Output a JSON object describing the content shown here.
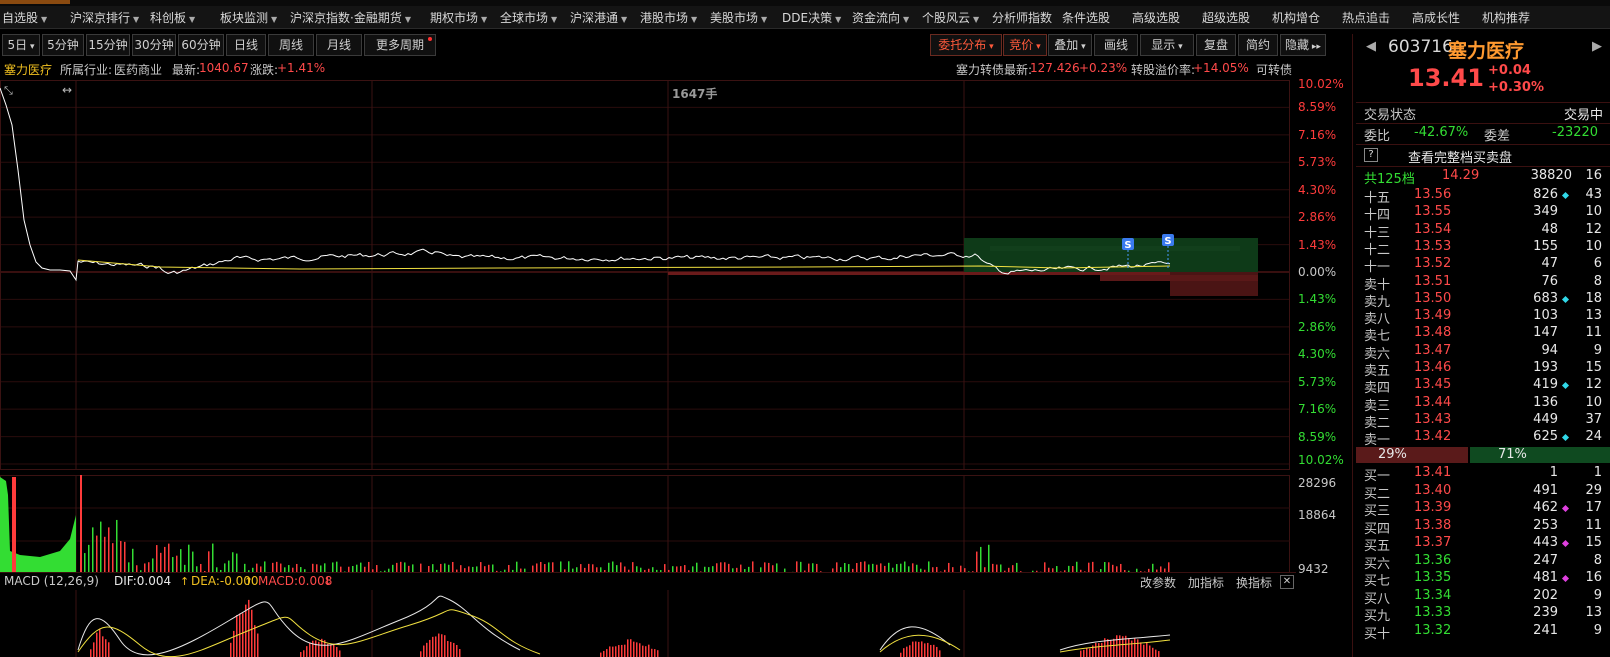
{
  "menu": [
    {
      "label": "自选股",
      "dd": true
    },
    {
      "label": "沪深京排行",
      "dd": true
    },
    {
      "label": "科创板",
      "dd": true
    },
    {
      "label": "板块监测",
      "dd": true
    },
    {
      "label": "沪深京指数·金融期货",
      "dd": true
    },
    {
      "label": "期权市场",
      "dd": true
    },
    {
      "label": "全球市场",
      "dd": true
    },
    {
      "label": "沪深港通",
      "dd": true
    },
    {
      "label": "港股市场",
      "dd": true
    },
    {
      "label": "美股市场",
      "dd": true
    },
    {
      "label": "DDE决策",
      "dd": true
    },
    {
      "label": "资金流向",
      "dd": true
    },
    {
      "label": "个股风云",
      "dd": true
    },
    {
      "label": "分析师指数",
      "dd": false
    },
    {
      "label": "条件选股",
      "dd": false
    },
    {
      "label": "高级选股",
      "dd": false
    },
    {
      "label": "超级选股",
      "dd": false
    },
    {
      "label": "机构增仓",
      "dd": false
    },
    {
      "label": "热点追击",
      "dd": false
    },
    {
      "label": "高成长性",
      "dd": false
    },
    {
      "label": "机构推荐",
      "dd": false
    }
  ],
  "periods": [
    "5日",
    "5分钟",
    "15分钟",
    "30分钟",
    "60分钟",
    "日线",
    "周线",
    "月线",
    "更多周期"
  ],
  "tools": [
    "委托分布",
    "竞价",
    "叠加",
    "画线",
    "显示",
    "复盘",
    "简约",
    "隐藏"
  ],
  "info": {
    "name": "塞力医疗",
    "industry_label": "所属行业:",
    "industry": "医药商业",
    "last_label": "最新:",
    "last": "1040.67",
    "chg_label": "涨跌:",
    "chg": "+1.41%",
    "cb_label": "塞力转债最新:",
    "cb_price": "127.426",
    "cb_chg": "+0.23%",
    "premium_label": "转股溢价率:",
    "premium": "+14.05%",
    "convertible": "可转债"
  },
  "chart": {
    "center_text": "1647手",
    "pct_up": [
      "10.02%",
      "8.59%",
      "7.16%",
      "5.73%",
      "4.30%",
      "2.86%",
      "1.43%"
    ],
    "pct_zero": "0.00%",
    "pct_down": [
      "1.43%",
      "2.86%",
      "4.30%",
      "5.73%",
      "7.16%",
      "8.59%",
      "10.02%"
    ],
    "vol_labels": [
      "28296",
      "18864",
      "9432"
    ],
    "marker": "S",
    "colors": {
      "up": "#ff3b3b",
      "down": "#33dd33",
      "price_line": "#ffffff",
      "avg_line": "#f0e040",
      "grid": "#2a0c0c"
    }
  },
  "macd": {
    "name": "MACD (12,26,9)",
    "dif": "DIF:0.004",
    "dea": "DEA:-0.000",
    "macd": "MACD:0.008",
    "btn_params": "改参数",
    "btn_add": "加指标",
    "btn_switch": "换指标",
    "close": "✕"
  },
  "stock": {
    "code": "603716",
    "name": "塞力医疗",
    "price": "13.41",
    "change": "+0.04",
    "change_pct": "+0.30%",
    "status_label": "交易状态",
    "status": "交易中",
    "weibi_label": "委比",
    "weibi": "-42.67%",
    "weicha_label": "委差",
    "weicha": "-23220",
    "help": "?",
    "full_book": "查看完整档买卖盘",
    "total_label": "共125档",
    "total_price": "14.29",
    "total_vol": "38820",
    "total_count": "16"
  },
  "asks": [
    {
      "label": "十五",
      "price": "13.56",
      "vol": "826",
      "mark": "cyan",
      "count": "43"
    },
    {
      "label": "十四",
      "price": "13.55",
      "vol": "349",
      "mark": "",
      "count": "10"
    },
    {
      "label": "十三",
      "price": "13.54",
      "vol": "48",
      "mark": "",
      "count": "12"
    },
    {
      "label": "十二",
      "price": "13.53",
      "vol": "155",
      "mark": "",
      "count": "10"
    },
    {
      "label": "十一",
      "price": "13.52",
      "vol": "47",
      "mark": "",
      "count": "6"
    },
    {
      "label": "卖十",
      "price": "13.51",
      "vol": "76",
      "mark": "",
      "count": "8"
    },
    {
      "label": "卖九",
      "price": "13.50",
      "vol": "683",
      "mark": "cyan",
      "count": "18"
    },
    {
      "label": "卖八",
      "price": "13.49",
      "vol": "103",
      "mark": "",
      "count": "13"
    },
    {
      "label": "卖七",
      "price": "13.48",
      "vol": "147",
      "mark": "",
      "count": "11"
    },
    {
      "label": "卖六",
      "price": "13.47",
      "vol": "94",
      "mark": "",
      "count": "9"
    },
    {
      "label": "卖五",
      "price": "13.46",
      "vol": "193",
      "mark": "",
      "count": "15"
    },
    {
      "label": "卖四",
      "price": "13.45",
      "vol": "419",
      "mark": "cyan",
      "count": "12"
    },
    {
      "label": "卖三",
      "price": "13.44",
      "vol": "136",
      "mark": "",
      "count": "10"
    },
    {
      "label": "卖二",
      "price": "13.43",
      "vol": "449",
      "mark": "",
      "count": "37"
    },
    {
      "label": "卖一",
      "price": "13.42",
      "vol": "625",
      "mark": "cyan",
      "count": "24"
    }
  ],
  "ratio": {
    "sell": "29%",
    "buy": "71%",
    "sell_frac": 0.29
  },
  "bids": [
    {
      "label": "买一",
      "price": "13.41",
      "vol": "1",
      "mark": "",
      "count": "1"
    },
    {
      "label": "买二",
      "price": "13.40",
      "vol": "491",
      "mark": "",
      "count": "29"
    },
    {
      "label": "买三",
      "price": "13.39",
      "vol": "462",
      "mark": "magenta",
      "count": "17"
    },
    {
      "label": "买四",
      "price": "13.38",
      "vol": "253",
      "mark": "",
      "count": "11"
    },
    {
      "label": "买五",
      "price": "13.37",
      "vol": "443",
      "mark": "magenta",
      "count": "15"
    },
    {
      "label": "买六",
      "price": "13.36",
      "vol": "247",
      "mark": "",
      "count": "8"
    },
    {
      "label": "买七",
      "price": "13.35",
      "vol": "481",
      "mark": "magenta",
      "count": "16"
    },
    {
      "label": "买八",
      "price": "13.34",
      "vol": "202",
      "mark": "",
      "count": "9"
    },
    {
      "label": "买九",
      "price": "13.33",
      "vol": "239",
      "mark": "",
      "count": "13"
    },
    {
      "label": "买十",
      "price": "13.32",
      "vol": "241",
      "mark": "",
      "count": "9"
    }
  ]
}
